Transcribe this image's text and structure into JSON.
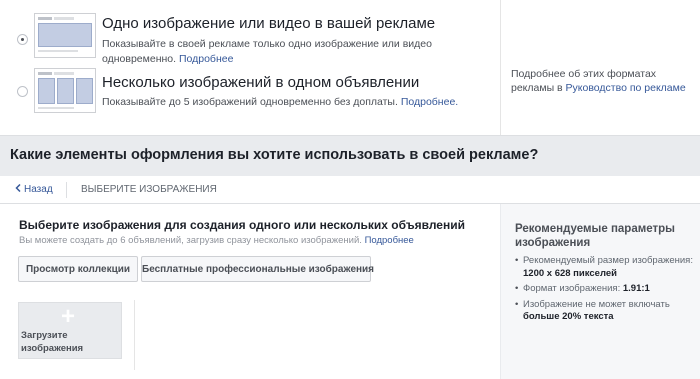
{
  "formats": [
    {
      "title": "Одно изображение или видео в вашей рекламе",
      "description": "Показывайте в своей рекламе только одно изображение или видео одновременно.",
      "link": "Подробнее",
      "selected": true,
      "thumbnail_icon": "single-image-ad-thumbnail"
    },
    {
      "title": "Несколько изображений в одном объявлении",
      "description": "Показывайте до 5 изображений одновременно без доплаты.",
      "link": "Подробнее.",
      "selected": false,
      "thumbnail_icon": "carousel-ad-thumbnail"
    }
  ],
  "format_help": {
    "text": "Подробнее об этих форматах рекламы в",
    "link": "Руководство по рекламе"
  },
  "section": {
    "heading": "Какие элементы оформления вы хотите использовать в своей рекламе?"
  },
  "nav": {
    "back_icon": "chevron-left-icon",
    "back_label": "Назад",
    "breadcrumb": "ВЫБЕРИТЕ ИЗОБРАЖЕНИЯ"
  },
  "main": {
    "title": "Выберите изображения для создания одного или нескольких объявлений",
    "subtitle": "Вы можете создать до 6 объявлений, загрузив сразу несколько изображений.",
    "subtitle_link": "Подробнее",
    "buttons": {
      "browse": "Просмотр коллекции",
      "stock": "Бесплатные профессиональные изображения"
    },
    "upload": {
      "icon": "+",
      "label": "Загрузите изображения"
    }
  },
  "recommendations": {
    "title": "Рекомендуемые параметры изображения",
    "size_label": "Рекомендуемый размер изображения:",
    "size_value": "1200 x 628 пикселей",
    "ratio_label": "Формат изображения:",
    "ratio_value": "1.91:1",
    "text_label": "Изображение не может включать",
    "text_value": "больше 20% текста"
  },
  "colors": {
    "link": "#365899",
    "background": "#e9ebee",
    "panel": "#ffffff"
  }
}
